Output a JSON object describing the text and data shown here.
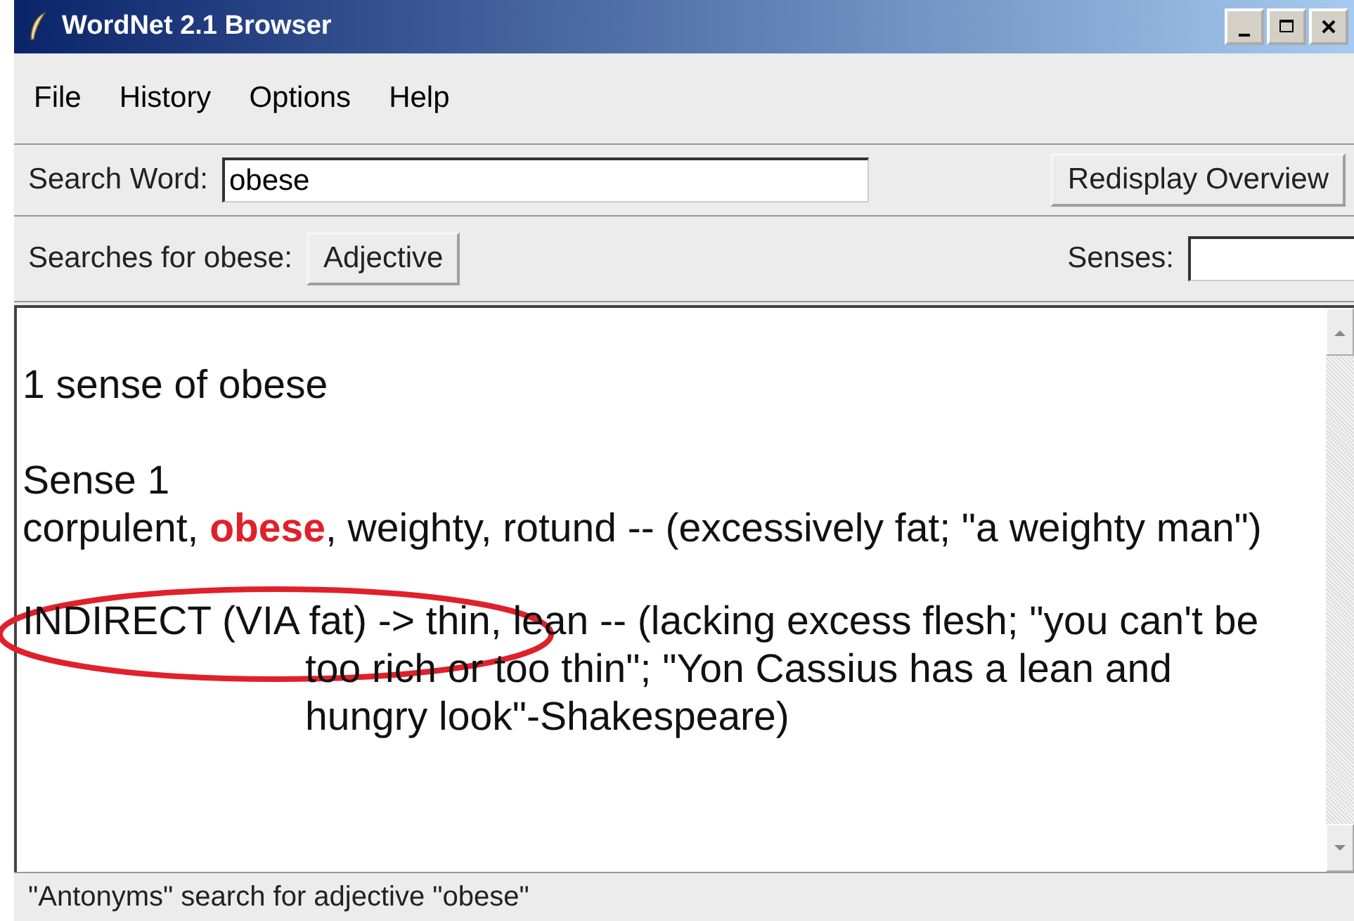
{
  "window": {
    "title": "WordNet 2.1 Browser"
  },
  "menu": [
    "File",
    "History",
    "Options",
    "Help"
  ],
  "search": {
    "label": "Search Word:",
    "value": "obese",
    "button": "Redisplay Overview"
  },
  "searches": {
    "label": "Searches for obese:",
    "buttons": [
      "Adjective"
    ],
    "senses_label": "Senses:"
  },
  "results": {
    "heading": "1 sense of obese",
    "sense_label": "Sense 1",
    "sense_text": "corpulent, **obese**, weighty, rotund -- (excessively fat; \"a weighty man\")",
    "antonym": "INDIRECT (VIA fat) -> thin, lean -- (lacking excess flesh; \"you can't be too rich or too thin\"; \"Yon Cassius has a lean and hungry look\"-Shakespeare)",
    "annotation": {
      "kind": "ellipse",
      "color": "#e0202a"
    }
  },
  "status_bar": "\"Antonyms\" search for adjective \"obese\""
}
